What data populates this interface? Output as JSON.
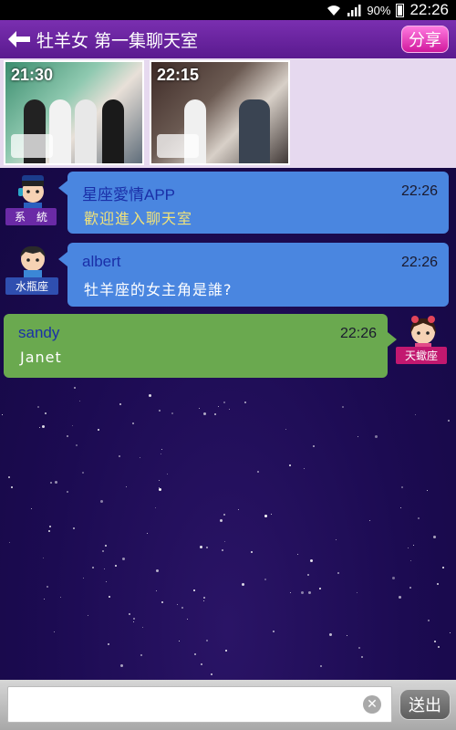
{
  "status_bar": {
    "battery_percent": "90%",
    "time": "22:26"
  },
  "title_bar": {
    "title": "牡羊女 第一集聊天室",
    "share_label": "分享"
  },
  "episodes": [
    {
      "time": "21:30"
    },
    {
      "time": "22:15"
    }
  ],
  "messages": [
    {
      "sender": "星座愛情APP",
      "sender_color": "#1a2fa8",
      "time": "22:26",
      "text": "歡迎進入聊天室",
      "text_color": "#f0e27a",
      "avatar_label": "系　統",
      "avatar_label_color": "#6a2aa6",
      "side": "left",
      "bubble_color": "#4a86e0"
    },
    {
      "sender": "albert",
      "sender_color": "#1a2fa8",
      "time": "22:26",
      "text": "牡羊座的女主角是誰?",
      "text_color": "#ffffff",
      "avatar_label": "水瓶座",
      "avatar_label_color": "#2f4fb0",
      "side": "left",
      "bubble_color": "#4a86e0"
    },
    {
      "sender": "sandy",
      "sender_color": "#1a2fa8",
      "time": "22:26",
      "text": "Janet",
      "text_color": "#ffffff",
      "avatar_label": "天蠍座",
      "avatar_label_color": "#c2186f",
      "side": "right",
      "bubble_color": "#6aa94f"
    }
  ],
  "input": {
    "value": "",
    "placeholder": "",
    "send_label": "送出"
  },
  "colors": {
    "title_bar": "#6a23a0",
    "episode_strip": "#e6d9ef",
    "chat_background": "#1c0b52",
    "share_button": "#e23ab8"
  }
}
